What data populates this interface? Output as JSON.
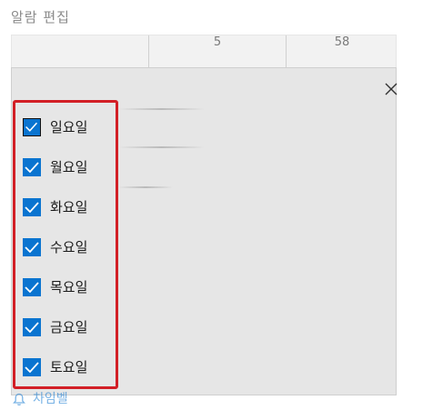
{
  "page": {
    "title": "알람 편집"
  },
  "time_picker": {
    "hour": "5",
    "minute": "58"
  },
  "repeat_days": [
    {
      "label": "일요일",
      "checked": true,
      "focused": true
    },
    {
      "label": "월요일",
      "checked": true
    },
    {
      "label": "화요일",
      "checked": true
    },
    {
      "label": "수요일",
      "checked": true
    },
    {
      "label": "목요일",
      "checked": true
    },
    {
      "label": "금요일",
      "checked": true
    },
    {
      "label": "토요일",
      "checked": true
    }
  ],
  "sound": {
    "label": "차임벨",
    "icon": "bell-icon"
  },
  "colors": {
    "accent": "#0a74d0",
    "highlight_border": "#d21f26",
    "popup_bg": "#e6e6e6"
  }
}
